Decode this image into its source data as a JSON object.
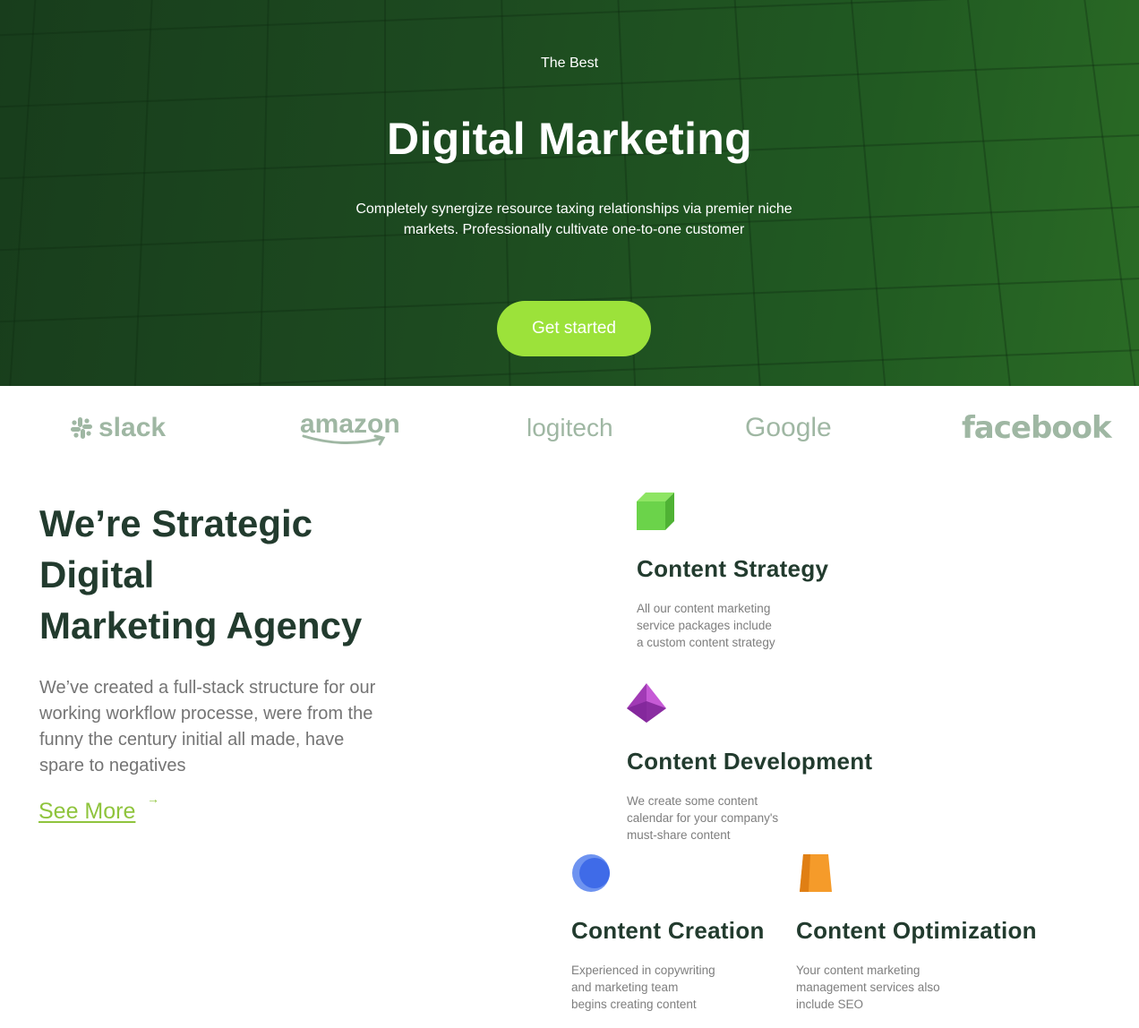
{
  "hero": {
    "eyebrow": "The Best",
    "title": "Digital Marketing",
    "description": "Completely synergize resource taxing relationships via premier niche markets. Professionally cultivate one-to-one customer",
    "cta_label": "Get started"
  },
  "logos": {
    "slack": "slack",
    "amazon": "amazon",
    "logitech": "logitech",
    "google": "Google",
    "facebook": "facebook"
  },
  "agency": {
    "title_lines": [
      "We’re Strategic",
      "Digital",
      "Marketing Agency"
    ],
    "description": "We’ve created a full-stack structure for our working workflow processe, were from the funny the century initial all made, have spare to negatives",
    "link_label": "See More",
    "link_arrow": "→"
  },
  "services": {
    "strategy": {
      "icon": "green-cube-icon",
      "title": "Content Strategy",
      "desc_lines": [
        "All our content marketing",
        "service packages include",
        "a custom content strategy"
      ]
    },
    "development": {
      "icon": "purple-gem-icon",
      "title": "Content Development",
      "desc_lines": [
        "We create some content",
        "calendar for your company's",
        "must-share content"
      ]
    },
    "creation": {
      "icon": "blue-circle-icon",
      "title": "Content Creation",
      "desc_lines": [
        "Experienced in copywriting",
        "and marketing team",
        "begins creating content"
      ]
    },
    "optimization": {
      "icon": "orange-cup-icon",
      "title": "Content Optimization",
      "desc_lines": [
        "Your content marketing",
        "management services also",
        "include SEO"
      ]
    }
  },
  "colors": {
    "hero_dark": "#183d1c",
    "hero_light": "#2a6b25",
    "accent": "#9ce23a",
    "heading": "#223b2e",
    "link": "#8fc43d",
    "logo_gray": "#9fb7a3"
  }
}
